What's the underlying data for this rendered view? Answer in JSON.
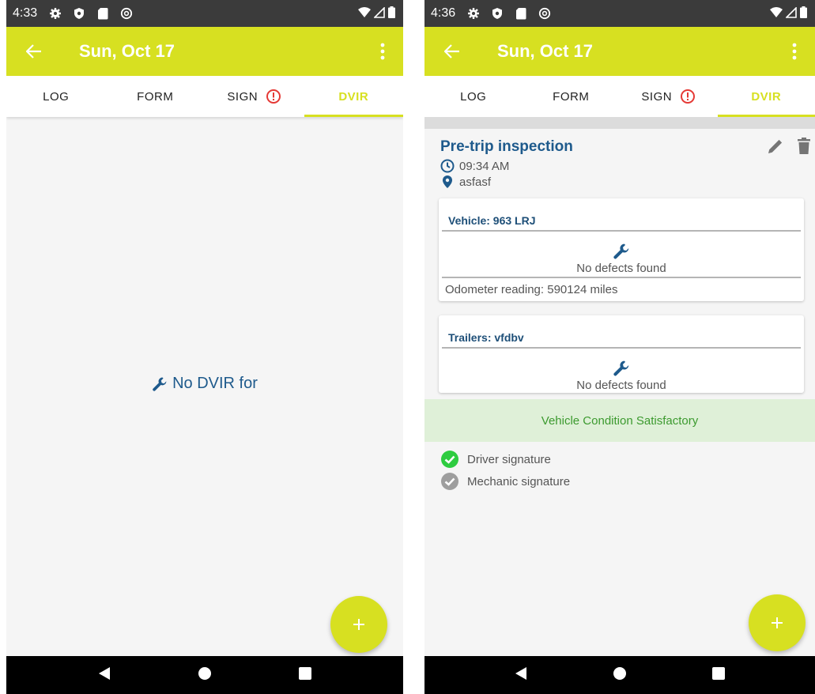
{
  "left": {
    "status": {
      "time": "4:33"
    },
    "appbar": {
      "title": "Sun, Oct 17"
    },
    "tabs": [
      {
        "label": "LOG"
      },
      {
        "label": "FORM"
      },
      {
        "label": "SIGN"
      },
      {
        "label": "DVIR"
      }
    ],
    "empty_text": "No DVIR for",
    "fab_label": "+"
  },
  "right": {
    "status": {
      "time": "4:36"
    },
    "appbar": {
      "title": "Sun, Oct 17"
    },
    "tabs": [
      {
        "label": "LOG"
      },
      {
        "label": "FORM"
      },
      {
        "label": "SIGN"
      },
      {
        "label": "DVIR"
      }
    ],
    "inspection": {
      "title": "Pre-trip inspection",
      "time": "09:34 AM",
      "location": "asfasf"
    },
    "vehicle_card": {
      "header": "Vehicle: 963 LRJ",
      "defects": "No defects found",
      "odometer": "Odometer reading: 590124 miles"
    },
    "trailer_card": {
      "header": "Trailers: vfdbv",
      "defects": "No defects found"
    },
    "condition": "Vehicle Condition Satisfactory",
    "signatures": {
      "driver": "Driver signature",
      "mechanic": "Mechanic signature"
    },
    "fab_label": "+"
  },
  "colors": {
    "accent": "#d7e021",
    "title_blue": "#1e5a8c",
    "warning_red": "#e53935",
    "success_green": "#2ecc40",
    "status_bar": "#3b3b3b"
  },
  "icons": {
    "back": "arrow-left-icon",
    "more": "more-vert-icon",
    "warning": "alert-circle-icon",
    "wrench": "wrench-icon",
    "clock": "clock-icon",
    "pin": "location-pin-icon",
    "edit": "pencil-icon",
    "delete": "trash-icon",
    "check": "check-circle-icon"
  }
}
